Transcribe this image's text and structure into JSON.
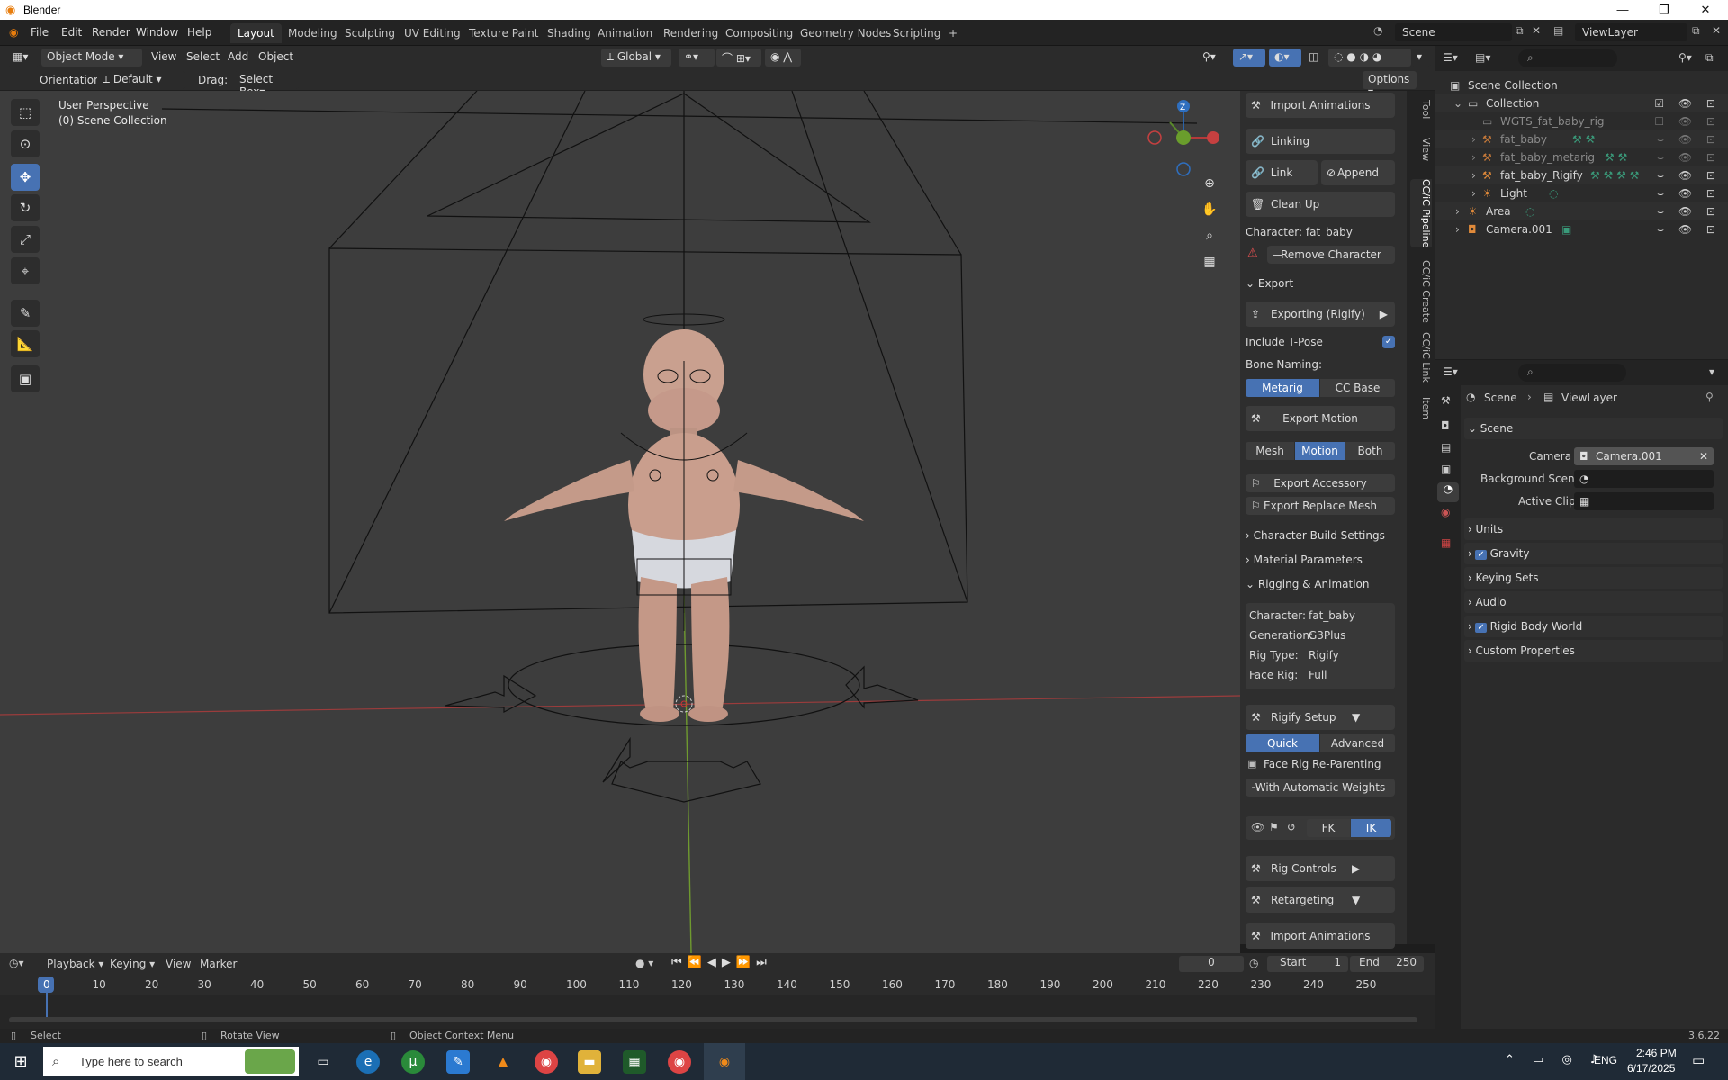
{
  "window": {
    "title": "Blender",
    "controls": [
      "—",
      "❐",
      "✕"
    ]
  },
  "menubar": {
    "menus": [
      "File",
      "Edit",
      "Render",
      "Window",
      "Help"
    ],
    "workspaces": [
      "Layout",
      "Modeling",
      "Sculpting",
      "UV Editing",
      "Texture Paint",
      "Shading",
      "Animation",
      "Rendering",
      "Compositing",
      "Geometry Nodes",
      "Scripting"
    ],
    "add_workspace": "+",
    "scene": "Scene",
    "view_layer": "ViewLayer"
  },
  "viewport_header": {
    "mode": "Object Mode",
    "menus": [
      "View",
      "Select",
      "Add",
      "Object"
    ],
    "transform": "Global",
    "orientation_label": "Orientation:",
    "orientation_value": "Default",
    "drag_label": "Drag:",
    "drag_value": "Select Box",
    "options": "Options"
  },
  "viewport": {
    "perspective": "User Perspective",
    "collection": "(0) Scene Collection",
    "gizmo_axes": [
      "Z",
      "Y",
      "X"
    ]
  },
  "toolbar_icons": [
    "select-box-icon",
    "cursor-icon",
    "move-icon",
    "rotate-icon",
    "scale-icon",
    "transform-icon",
    "annotate-icon",
    "measure-icon",
    "add-cube-icon"
  ],
  "npanel": {
    "tabs": [
      "Tool",
      "View",
      "CC/iC Pipeline",
      "CC/iC Create",
      "CC/iC Link",
      "Item"
    ],
    "import_animations_top": "Import Animations",
    "linking": "Linking",
    "link": "Link",
    "append": "Append",
    "clean_up": "Clean Up",
    "character_label": "Character: fat_baby",
    "remove_character": "Remove Character",
    "export_section": "Export",
    "exporting": "Exporting (Rigify)",
    "include_tpose": "Include T-Pose",
    "bone_naming": "Bone Naming:",
    "bone_naming_options": [
      "Metarig",
      "CC Base"
    ],
    "export_motion": "Export Motion",
    "motion_options": [
      "Mesh",
      "Motion",
      "Both"
    ],
    "export_accessory": "Export Accessory",
    "export_replace_mesh": "Export Replace Mesh",
    "sections": [
      "Character Build Settings",
      "Material Parameters",
      "Rigging & Animation"
    ],
    "info": [
      {
        "key": "Character:",
        "value": "fat_baby"
      },
      {
        "key": "Generation:",
        "value": "G3Plus"
      },
      {
        "key": "Rig Type:",
        "value": "Rigify"
      },
      {
        "key": "Face Rig:",
        "value": "Full"
      }
    ],
    "rigify_setup": "Rigify Setup",
    "setup_options": [
      "Quick",
      "Advanced"
    ],
    "face_rig_reparenting": "Face Rig Re-Parenting",
    "with_auto_weights": "With Automatic Weights",
    "fk": "FK",
    "ik": "IK",
    "rig_controls": "Rig Controls",
    "retargeting": "Retargeting",
    "import_animations_bottom": "Import Animations"
  },
  "outliner": {
    "rows": [
      {
        "label": "Scene Collection",
        "indent": 0
      },
      {
        "label": "Collection",
        "indent": 1
      },
      {
        "label": "WGTS_fat_baby_rig",
        "indent": 2
      },
      {
        "label": "fat_baby",
        "indent": 2
      },
      {
        "label": "fat_baby_metarig",
        "indent": 2
      },
      {
        "label": "fat_baby_Rigify",
        "indent": 2
      },
      {
        "label": "Light",
        "indent": 2
      },
      {
        "label": "Area",
        "indent": 1
      },
      {
        "label": "Camera.001",
        "indent": 1
      }
    ]
  },
  "properties": {
    "breadcrumb": [
      "Scene",
      "ViewLayer"
    ],
    "scene_panel": "Scene",
    "camera_label": "Camera",
    "camera_value": "Camera.001",
    "background_scene_label": "Background Scene",
    "active_clip_label": "Active Clip",
    "panels": [
      "Units",
      "Gravity",
      "Keying Sets",
      "Audio",
      "Rigid Body World",
      "Custom Properties"
    ]
  },
  "timeline": {
    "menus": [
      "Playback",
      "Keying",
      "View",
      "Marker"
    ],
    "current_frame": "0",
    "start_label": "Start",
    "start_value": "1",
    "end_label": "End",
    "end_value": "250",
    "frames": [
      "0",
      "10",
      "20",
      "30",
      "40",
      "50",
      "60",
      "70",
      "80",
      "90",
      "100",
      "110",
      "120",
      "130",
      "140",
      "150",
      "160",
      "170",
      "180",
      "190",
      "200",
      "210",
      "220",
      "230",
      "240",
      "250"
    ]
  },
  "statusbar": {
    "select": "Select",
    "rotate": "Rotate View",
    "context": "Object Context Menu",
    "version": "3.6.22"
  },
  "taskbar": {
    "search_placeholder": "Type here to search",
    "lang": "ENG",
    "time": "2:46 PM",
    "date": "6/17/2025"
  }
}
